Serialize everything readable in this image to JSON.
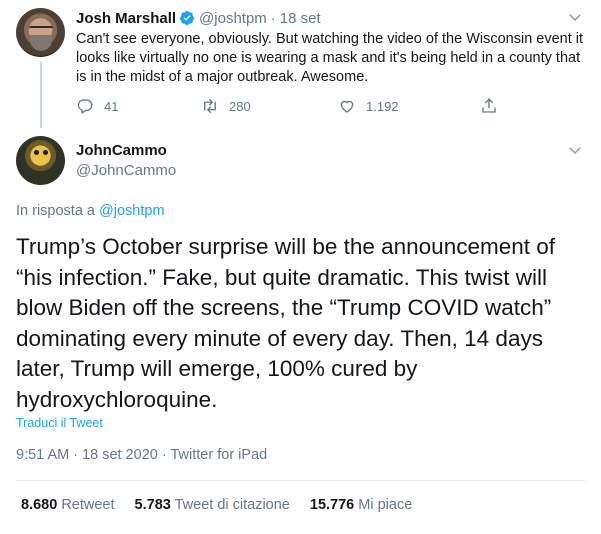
{
  "parent_tweet": {
    "name": "Josh Marshall",
    "handle": "@joshtpm",
    "separator": "·",
    "date": "18 set",
    "text": "Can't see everyone, obviously. But watching the video of the Wisconsin event it looks like virtually no one is wearing a mask and it's being held in a county that is in the midst of a major outbreak. Awesome.",
    "reply_count": "41",
    "retweet_count": "280",
    "like_count": "1.192"
  },
  "main_tweet": {
    "name": "JohnCammo",
    "handle": "@JohnCammo",
    "reply_prefix": "In risposta a",
    "reply_mention": "@joshtpm",
    "text": "Trump’s October surprise will be the announcement of “his infection.”  Fake, but quite dramatic. This twist will blow Biden off the screens, the “Trump COVID watch” dominating every minute of every day.  Then, 14 days later, Trump will emerge, 100% cured by hydroxychloroquine.",
    "translate_label": "Traduci il Tweet",
    "timestamp": "9:51 AM · 18 set 2020 · Twitter for iPad",
    "stats": [
      {
        "count": "8.680",
        "label": "Retweet"
      },
      {
        "count": "5.783",
        "label": "Tweet di citazione"
      },
      {
        "count": "15.776",
        "label": "Mi piace"
      }
    ]
  },
  "colors": {
    "accent": "#1da1f2",
    "secondary_text": "#657786",
    "border": "#e6ecf0"
  },
  "icons": [
    "verified-badge-icon",
    "chevron-down-icon",
    "reply-icon",
    "retweet-icon",
    "like-icon",
    "share-icon"
  ]
}
